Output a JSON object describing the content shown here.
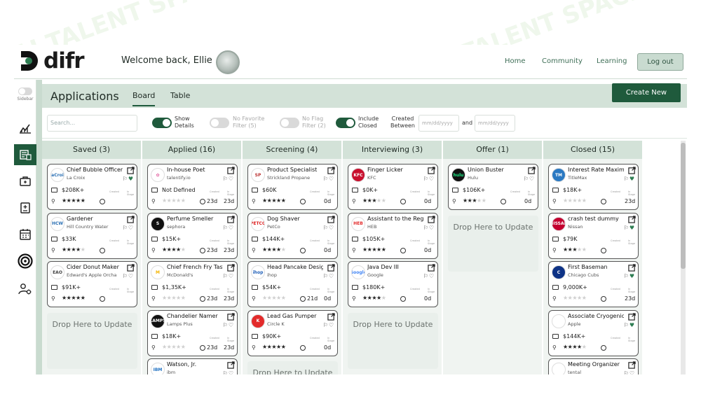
{
  "topbar": {
    "logo_text": "difr",
    "welcome": "Welcome back, Ellie",
    "nav": [
      "Home",
      "Community",
      "Learning"
    ],
    "logout": "Log out"
  },
  "sidebar": {
    "toggle_label": "Sidebar",
    "items": [
      "chart-icon",
      "applications-icon",
      "briefcase-icon",
      "document-icon",
      "calendar-icon",
      "target-icon",
      "user-settings-icon"
    ],
    "active_index": 1
  },
  "header": {
    "title": "Applications",
    "tabs": [
      "Board",
      "Table"
    ],
    "active_tab": "Board",
    "create_button": "Create New"
  },
  "filters": {
    "search_placeholder": "Search...",
    "show_details": [
      "Show",
      "Details"
    ],
    "no_favorite": [
      "No Favorite",
      "Filter (5)"
    ],
    "no_flag": [
      "No Flag",
      "Filter (2)"
    ],
    "include_closed": [
      "Include",
      "Closed"
    ],
    "created_between": [
      "Created",
      "Between"
    ],
    "date_placeholder": "mm/dd/yyyy",
    "and": "and"
  },
  "card_labels": {
    "created": "Created",
    "in_stage": "In Stage"
  },
  "drop_text": "Drop Here to Update",
  "columns": [
    {
      "title": "Saved (3)",
      "cards": [
        {
          "title": "Chief Bubble Officer",
          "company": "La Croix",
          "salary": "$208K+",
          "stars": 5,
          "days_created": "",
          "days_stage": "",
          "logo": "LaCroix",
          "logo_bg": "#ffffff",
          "logo_fg": "#2a6fb3",
          "fav": true
        },
        {
          "title": "Gardener",
          "company": "Hill Country Water",
          "salary": "$33K",
          "stars": 4,
          "days_created": "",
          "days_stage": "",
          "logo": "HCW",
          "logo_bg": "#ffffff",
          "logo_fg": "#2a6fb3",
          "fav": false
        },
        {
          "title": "Cider Donut Maker",
          "company": "Edward's Apple Orchard",
          "salary": "$91K+",
          "stars": 5,
          "days_created": "",
          "days_stage": "",
          "logo": "EAO",
          "logo_bg": "#ffffff",
          "logo_fg": "#444",
          "fav": false
        }
      ],
      "drop": true
    },
    {
      "title": "Applied (16)",
      "cards": [
        {
          "title": "In-house Poet",
          "company": "talentify.io",
          "salary": "Not Defined",
          "stars": 0,
          "days_created": "23d",
          "days_stage": "23d",
          "logo": "✿",
          "logo_bg": "#ffffff",
          "logo_fg": "#e05a9c",
          "fav": false
        },
        {
          "title": "Perfume Smeller",
          "company": "sephora",
          "salary": "$15K+",
          "stars": 4,
          "days_created": "23d",
          "days_stage": "23d",
          "logo": "S",
          "logo_bg": "#111111",
          "logo_fg": "#ffffff",
          "fav": false
        },
        {
          "title": "Chief French Fry Taster",
          "company": "McDonald's",
          "salary": "$1,35K+",
          "stars": 0,
          "days_created": "23d",
          "days_stage": "23d",
          "logo": "M",
          "logo_bg": "#ffffff",
          "logo_fg": "#f4b400",
          "fav": false
        },
        {
          "title": "Chandelier Namer",
          "company": "Lamps Plus",
          "salary": "$18K+",
          "stars": 0,
          "days_created": "23d",
          "days_stage": "23d",
          "logo": "LAMPS",
          "logo_bg": "#111111",
          "logo_fg": "#ffffff",
          "fav": false
        },
        {
          "title": "Watson, Jr.",
          "company": "ibm",
          "salary": "",
          "stars": 0,
          "days_created": "",
          "days_stage": "",
          "logo": "IBM",
          "logo_bg": "#ffffff",
          "logo_fg": "#1f70c1",
          "fav": false
        }
      ],
      "drop": false
    },
    {
      "title": "Screening (4)",
      "cards": [
        {
          "title": "Product Specialist",
          "company": "Strickland Propane",
          "salary": "$60K",
          "stars": 5,
          "days_created": "",
          "days_stage": "0d",
          "logo": "SP",
          "logo_bg": "#ffffff",
          "logo_fg": "#b33",
          "fav": false
        },
        {
          "title": "Dog Shaver",
          "company": "PetCo",
          "salary": "$144K+",
          "stars": 4,
          "days_created": "",
          "days_stage": "0d",
          "logo": "PETCO",
          "logo_bg": "#ffffff",
          "logo_fg": "#d22",
          "fav": false
        },
        {
          "title": "Head Pancake Designer",
          "company": "ihop",
          "salary": "$54K+",
          "stars": 0,
          "days_created": "21d",
          "days_stage": "0d",
          "logo": "ihop",
          "logo_bg": "#ffffff",
          "logo_fg": "#1f5fb8",
          "fav": false
        },
        {
          "title": "Lead Gas Pumper",
          "company": "Circle K",
          "salary": "$90K+",
          "stars": 5,
          "days_created": "",
          "days_stage": "0d",
          "logo": "K",
          "logo_bg": "#e32b2b",
          "logo_fg": "#ffffff",
          "fav": false
        }
      ],
      "drop": true
    },
    {
      "title": "Interviewing (3)",
      "cards": [
        {
          "title": "Finger Licker",
          "company": "KFC",
          "salary": "$0K+",
          "stars": 2.5,
          "days_created": "",
          "days_stage": "0d",
          "logo": "KFC",
          "logo_bg": "#c8102e",
          "logo_fg": "#ffffff",
          "fav": false
        },
        {
          "title": "Assistant to the Regional Manager",
          "company": "HEB",
          "salary": "$105K+",
          "stars": 5,
          "days_created": "",
          "days_stage": "0d",
          "logo": "HEB",
          "logo_bg": "#ffffff",
          "logo_fg": "#e32b2b",
          "fav": false
        },
        {
          "title": "Java Dev III",
          "company": "Google",
          "salary": "$180K+",
          "stars": 4,
          "days_created": "",
          "days_stage": "0d",
          "logo": "Google",
          "logo_bg": "#ffffff",
          "logo_fg": "#4285f4",
          "fav": false
        }
      ],
      "drop": true
    },
    {
      "title": "Offer (1)",
      "cards": [
        {
          "title": "Union Buster",
          "company": "Hulu",
          "salary": "$106K+",
          "stars": 2.5,
          "days_created": "",
          "days_stage": "0d",
          "logo": "hulu",
          "logo_bg": "#111111",
          "logo_fg": "#1ce783",
          "fav": false
        }
      ],
      "drop": true
    },
    {
      "title": "Closed (15)",
      "cards": [
        {
          "title": "Interest Rate Maximizer",
          "company": "TitleMax",
          "salary": "$18K+",
          "stars": 0,
          "days_created": "",
          "days_stage": "23d",
          "logo": "TM",
          "logo_bg": "#2b79c2",
          "logo_fg": "#ffffff",
          "fav": true
        },
        {
          "title": "crash test dummy",
          "company": "Nissan",
          "salary": "$79K",
          "stars": 2.5,
          "days_created": "",
          "days_stage": "",
          "logo": "NISSAN",
          "logo_bg": "#c3002f",
          "logo_fg": "#ffffff",
          "fav": true
        },
        {
          "title": "First Baseman",
          "company": "Chicago Cubs",
          "salary": "9,000K+",
          "stars": 0,
          "days_created": "",
          "days_stage": "23d",
          "logo": "C",
          "logo_bg": "#0e3386",
          "logo_fg": "#ffffff",
          "fav": true
        },
        {
          "title": "Associate Cryogenicist",
          "company": "Apple",
          "salary": "$144K+",
          "stars": 4,
          "days_created": "",
          "days_stage": "",
          "logo": "",
          "logo_bg": "#ffffff",
          "logo_fg": "#111",
          "fav": true
        },
        {
          "title": "Meeting Organizer",
          "company": "tental",
          "salary": "",
          "stars": 0,
          "days_created": "",
          "days_stage": "",
          "logo": "",
          "logo_bg": "#ffffff",
          "logo_fg": "#1f5fb8",
          "fav": false
        }
      ],
      "drop": false
    }
  ],
  "colors": {
    "brand": "#1f5a3c",
    "header_bg": "#d3e2d8",
    "column_bg": "#f0f4f1",
    "fav": "#2e7d52"
  },
  "watermark": "AI TALENT SPACE"
}
